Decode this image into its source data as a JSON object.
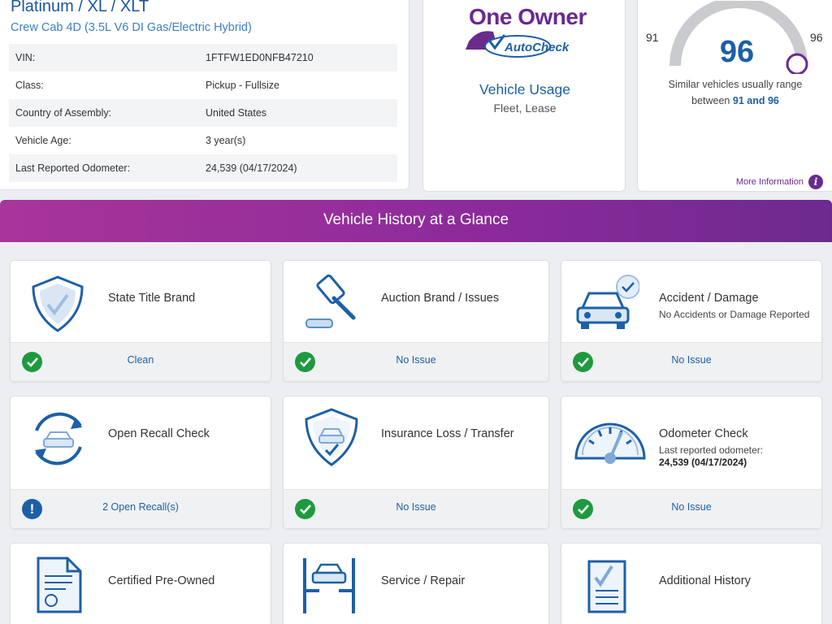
{
  "vehicle": {
    "title": "Platinum / XL / XLT",
    "subtitle": "Crew Cab 4D (3.5L V6 DI Gas/Electric Hybrid)",
    "specs": [
      {
        "label": "VIN:",
        "value": "1FTFW1ED0NFB47210"
      },
      {
        "label": "Class:",
        "value": "Pickup - Fullsize"
      },
      {
        "label": "Country of Assembly:",
        "value": "United States"
      },
      {
        "label": "Vehicle Age:",
        "value": "3 year(s)"
      },
      {
        "label": "Last Reported Odometer:",
        "value": "24,539 (04/17/2024)"
      }
    ]
  },
  "owner": {
    "logo_text": "One Owner",
    "logo_sub": "AutoCheck",
    "usage_title": "Vehicle Usage",
    "usage_value": "Fleet, Lease"
  },
  "score": {
    "value": "96",
    "range_min": "91",
    "range_max": "96",
    "desc_prefix": "Similar vehicles usually range",
    "desc_between": "between",
    "desc_range": "91 and 96",
    "more_info": "More Information",
    "info_glyph": "i"
  },
  "banner": {
    "title": "Vehicle History at a Glance"
  },
  "tiles": [
    {
      "label": "State Title Brand",
      "status": "Clean",
      "icon": "shield-check-icon"
    },
    {
      "label": "Auction Brand / Issues",
      "status": "No Issue",
      "icon": "gavel-icon"
    },
    {
      "label": "Accident / Damage",
      "sub": "No Accidents or Damage Reported",
      "status": "No Issue",
      "icon": "car-check-icon"
    },
    {
      "label": "Open Recall Check",
      "status": "2 Open Recall(s)",
      "icon": "recall-car-icon",
      "alert_glyph": "!"
    },
    {
      "label": "Insurance Loss / Transfer",
      "status": "No Issue",
      "icon": "shield-car-icon"
    },
    {
      "label": "Odometer Check",
      "sub": "Last reported odometer:",
      "sub2": "24,539 (04/17/2024)",
      "status": "No Issue",
      "icon": "odometer-icon"
    },
    {
      "label": "Certified Pre-Owned",
      "icon": "certificate-icon"
    },
    {
      "label": "Service / Repair",
      "icon": "car-lift-icon"
    },
    {
      "label": "Additional History",
      "icon": "checklist-icon"
    }
  ],
  "colors": {
    "brand_purple": "#6b2a8e",
    "link_blue": "#1d60a8",
    "check_green": "#1e9a3e"
  }
}
